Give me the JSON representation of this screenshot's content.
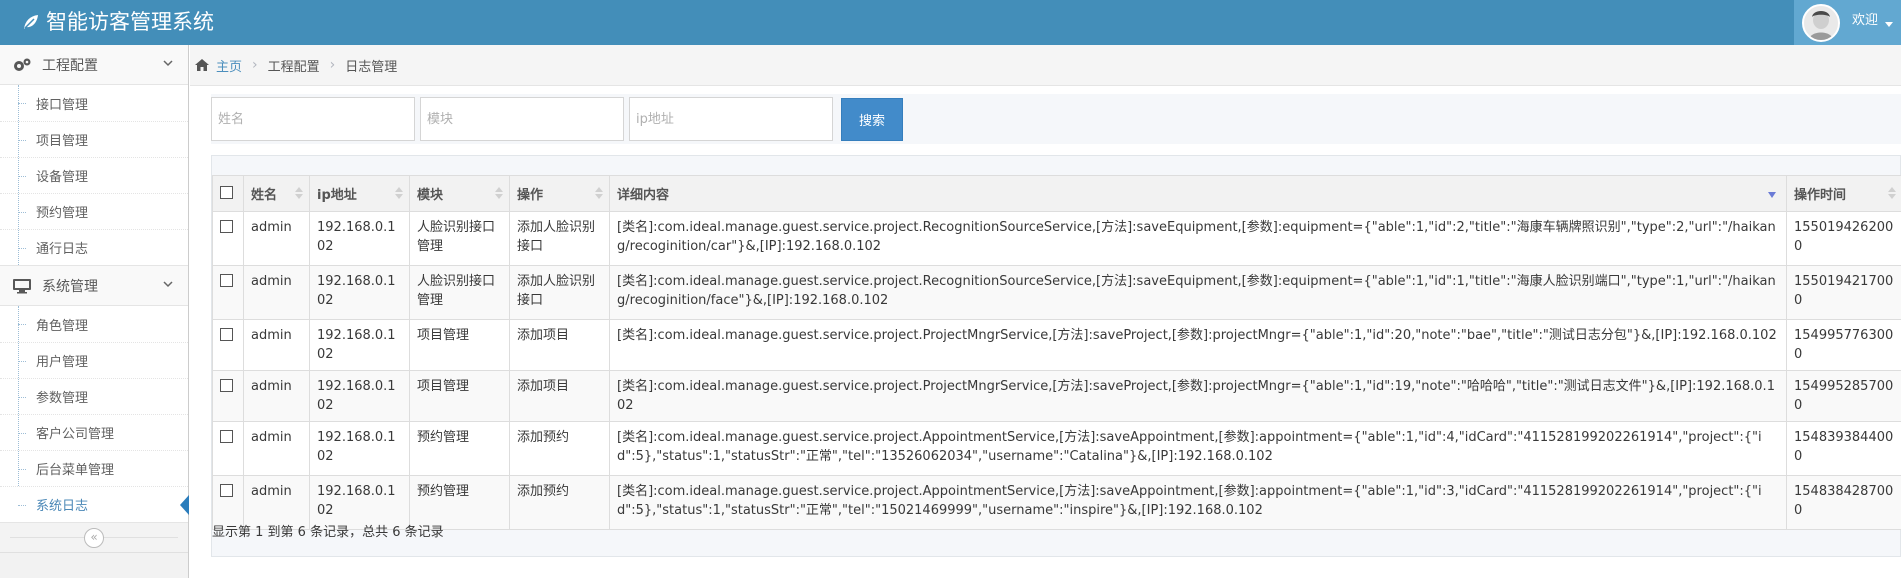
{
  "header": {
    "title": "智能访客管理系统",
    "welcome": "欢迎"
  },
  "sidebar": {
    "groups": [
      {
        "label": "工程配置",
        "icon": "gears-icon",
        "items": [
          "接口管理",
          "项目管理",
          "设备管理",
          "预约管理",
          "通行日志"
        ]
      },
      {
        "label": "系统管理",
        "icon": "desktop-icon",
        "items": [
          "角色管理",
          "用户管理",
          "参数管理",
          "客户公司管理",
          "后台菜单管理",
          "系统日志"
        ]
      }
    ],
    "active_item": "系统日志"
  },
  "breadcrumb": {
    "home": "主页",
    "level1": "工程配置",
    "level2": "日志管理"
  },
  "search": {
    "name_placeholder": "姓名",
    "module_placeholder": "模块",
    "ip_placeholder": "ip地址",
    "button": "搜索"
  },
  "table": {
    "columns": [
      "姓名",
      "ip地址",
      "模块",
      "操作",
      "详细内容",
      "操作时间"
    ],
    "rows": [
      {
        "name": "admin",
        "ip": "192.168.0.102",
        "module": "人脸识别接口管理",
        "operation": "添加人脸识别接口",
        "detail": "[类名]:com.ideal.manage.guest.service.project.RecognitionSourceService,[方法]:saveEquipment,[参数]:equipment={\"able\":1,\"id\":2,\"title\":\"海康车辆牌照识别\",\"type\":2,\"url\":\"/haikang/recoginition/car\"}&,[IP]:192.168.0.102",
        "time": "1550194262000"
      },
      {
        "name": "admin",
        "ip": "192.168.0.102",
        "module": "人脸识别接口管理",
        "operation": "添加人脸识别接口",
        "detail": "[类名]:com.ideal.manage.guest.service.project.RecognitionSourceService,[方法]:saveEquipment,[参数]:equipment={\"able\":1,\"id\":1,\"title\":\"海康人脸识别端口\",\"type\":1,\"url\":\"/haikang/recoginition/face\"}&,[IP]:192.168.0.102",
        "time": "1550194217000"
      },
      {
        "name": "admin",
        "ip": "192.168.0.102",
        "module": "项目管理",
        "operation": "添加项目",
        "detail": "[类名]:com.ideal.manage.guest.service.project.ProjectMngrService,[方法]:saveProject,[参数]:projectMngr={\"able\":1,\"id\":20,\"note\":\"bae\",\"title\":\"测试日志分包\"}&,[IP]:192.168.0.102",
        "time": "1549957763000"
      },
      {
        "name": "admin",
        "ip": "192.168.0.102",
        "module": "项目管理",
        "operation": "添加项目",
        "detail": "[类名]:com.ideal.manage.guest.service.project.ProjectMngrService,[方法]:saveProject,[参数]:projectMngr={\"able\":1,\"id\":19,\"note\":\"哈哈哈\",\"title\":\"测试日志文件\"}&,[IP]:192.168.0.102",
        "time": "1549952857000"
      },
      {
        "name": "admin",
        "ip": "192.168.0.102",
        "module": "预约管理",
        "operation": "添加预约",
        "detail": "[类名]:com.ideal.manage.guest.service.project.AppointmentService,[方法]:saveAppointment,[参数]:appointment={\"able\":1,\"id\":4,\"idCard\":\"411528199202261914\",\"project\":{\"id\":5},\"status\":1,\"statusStr\":\"正常\",\"tel\":\"13526062034\",\"username\":\"Catalina\"}&,[IP]:192.168.0.102",
        "time": "1548393844000"
      },
      {
        "name": "admin",
        "ip": "192.168.0.102",
        "module": "预约管理",
        "operation": "添加预约",
        "detail": "[类名]:com.ideal.manage.guest.service.project.AppointmentService,[方法]:saveAppointment,[参数]:appointment={\"able\":1,\"id\":3,\"idCard\":\"411528199202261914\",\"project\":{\"id\":5},\"status\":1,\"statusStr\":\"正常\",\"tel\":\"15021469999\",\"username\":\"inspire\"}&,[IP]:192.168.0.102",
        "time": "1548384287000"
      }
    ],
    "pagination_info": "显示第 1 到第 6 条记录，总共 6 条记录"
  },
  "colors": {
    "navbar": "#438eb9",
    "user_box": "#62a8d1",
    "primary_button": "#428bca",
    "active_link": "#4b88b7"
  }
}
